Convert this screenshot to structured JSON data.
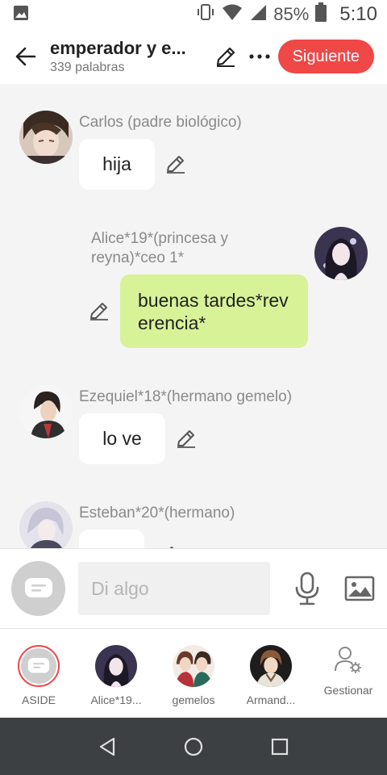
{
  "status_bar": {
    "battery": "85%",
    "time": "5:10"
  },
  "header": {
    "title": "emperador y e...",
    "subtitle": "339 palabras",
    "next_label": "Siguiente"
  },
  "messages": [
    {
      "sender": "Carlos (padre biológico)",
      "text": "hija",
      "side": "left"
    },
    {
      "sender": "Alice*19*(princesa y reyna)*ceo 1*",
      "text": "buenas tardes*reverencia*",
      "side": "right"
    },
    {
      "sender": "Ezequiel*18*(hermano gemelo)",
      "text": "lo ve",
      "side": "left"
    },
    {
      "sender": "Esteban*20*(hermano)",
      "text": "",
      "side": "left"
    }
  ],
  "input": {
    "placeholder": "Di algo"
  },
  "characters": [
    {
      "label": "ASIDE"
    },
    {
      "label": "Alice*19..."
    },
    {
      "label": "gemelos"
    },
    {
      "label": "Armand..."
    }
  ],
  "manage_label": "Gestionar",
  "colors": {
    "accent": "#f04747",
    "own_bubble": "#d8f298",
    "navbar": "#3c4043"
  }
}
